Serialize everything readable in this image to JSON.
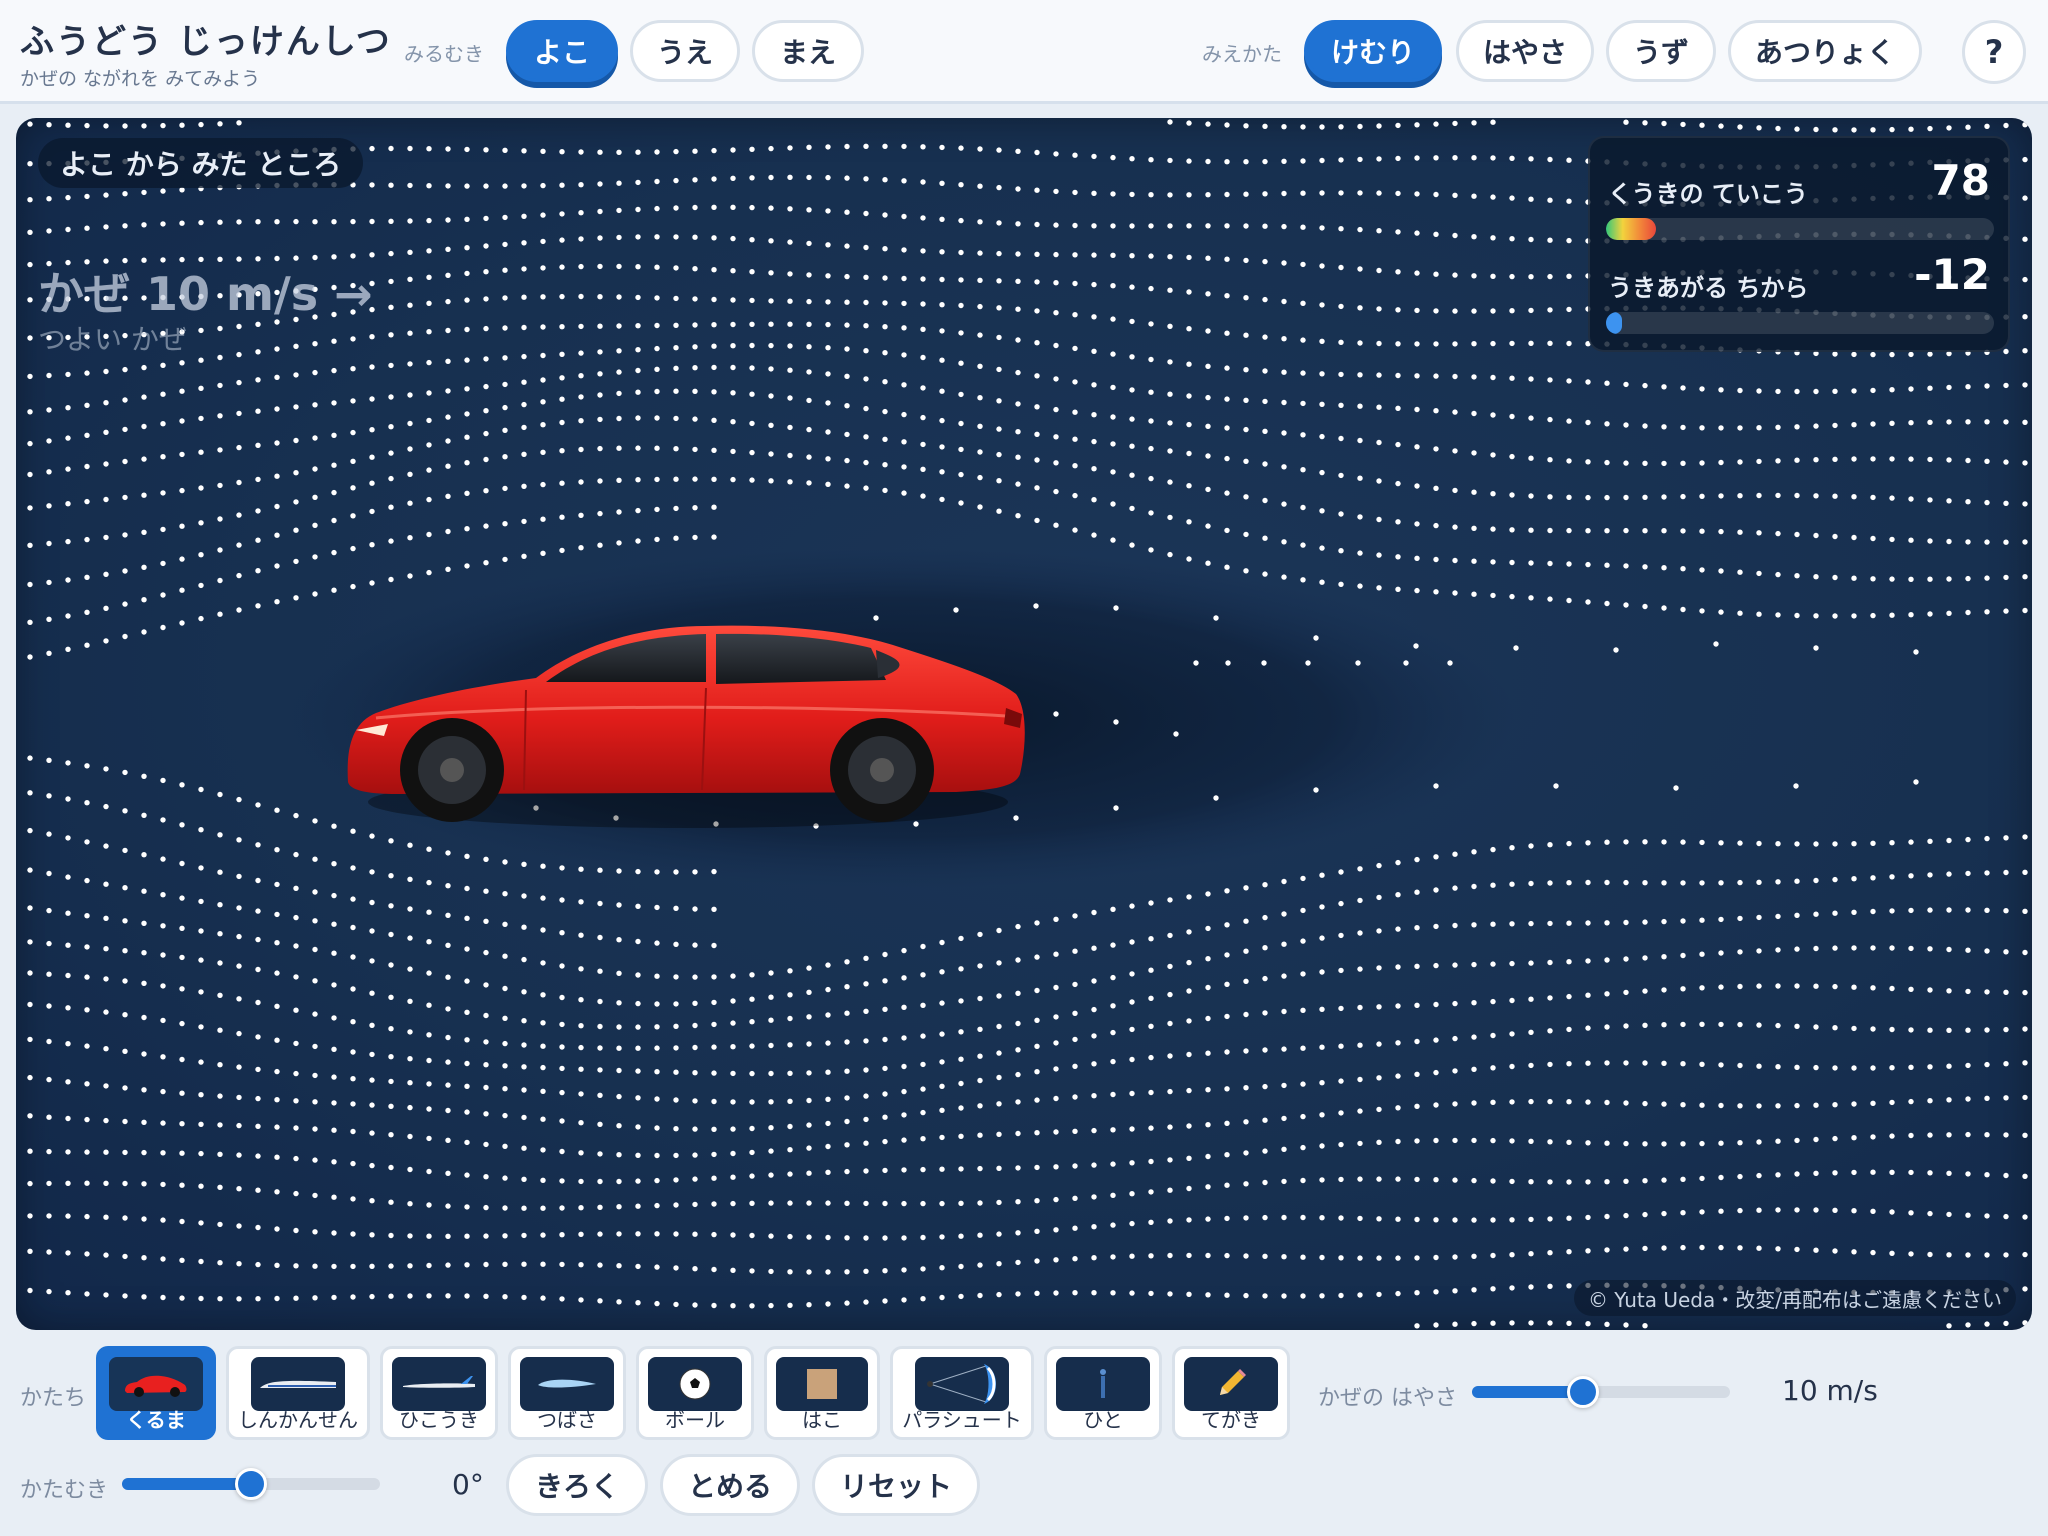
{
  "header": {
    "title": "ふうどう じっけんしつ",
    "subtitle": "かぜの ながれを みてみよう",
    "view_direction_label": "みるむき",
    "view_directions": [
      "よこ",
      "うえ",
      "まえ"
    ],
    "view_direction_selected": "よこ",
    "display_mode_label": "みえかた",
    "display_modes": [
      "けむり",
      "はやさ",
      "うず",
      "あつりょく"
    ],
    "display_mode_selected": "けむり",
    "help_label": "?"
  },
  "tunnel": {
    "view_label": "よこ から みた ところ",
    "wind_text": "かぜ 10 m/s →",
    "wind_description": "つよい かぜ",
    "stats": {
      "drag_label": "くうきの ていこう",
      "drag_value": "78",
      "drag_fraction": 0.13,
      "lift_label": "うきあがる ちから",
      "lift_value": "-12",
      "lift_fraction": 0.04
    },
    "copyright": "© Yuta Ueda・改変/再配布はご遠慮ください",
    "colors": {
      "background": "#173050",
      "smoke": "#ffffff",
      "car": "#e8201f"
    }
  },
  "controls": {
    "shape_label": "かたち",
    "shapes": [
      {
        "name": "くるま",
        "icon": "car-icon"
      },
      {
        "name": "しんかんせん",
        "icon": "bullet-train-icon"
      },
      {
        "name": "ひこうき",
        "icon": "airplane-icon"
      },
      {
        "name": "つばさ",
        "icon": "wing-icon"
      },
      {
        "name": "ボール",
        "icon": "soccer-ball-icon"
      },
      {
        "name": "はこ",
        "icon": "box-icon"
      },
      {
        "name": "パラシュート",
        "icon": "parachute-icon"
      },
      {
        "name": "ひと",
        "icon": "person-icon"
      },
      {
        "name": "てがき",
        "icon": "pencil-icon"
      }
    ],
    "shape_selected": "くるま",
    "wind_speed_label": "かぜの はやさ",
    "wind_speed_value": "10 m/s",
    "wind_speed_fraction": 0.43,
    "angle_label": "かたむき",
    "angle_value": "0°",
    "angle_fraction": 0.5,
    "record_button": "きろく",
    "stop_button": "とめる",
    "reset_button": "リセット"
  }
}
